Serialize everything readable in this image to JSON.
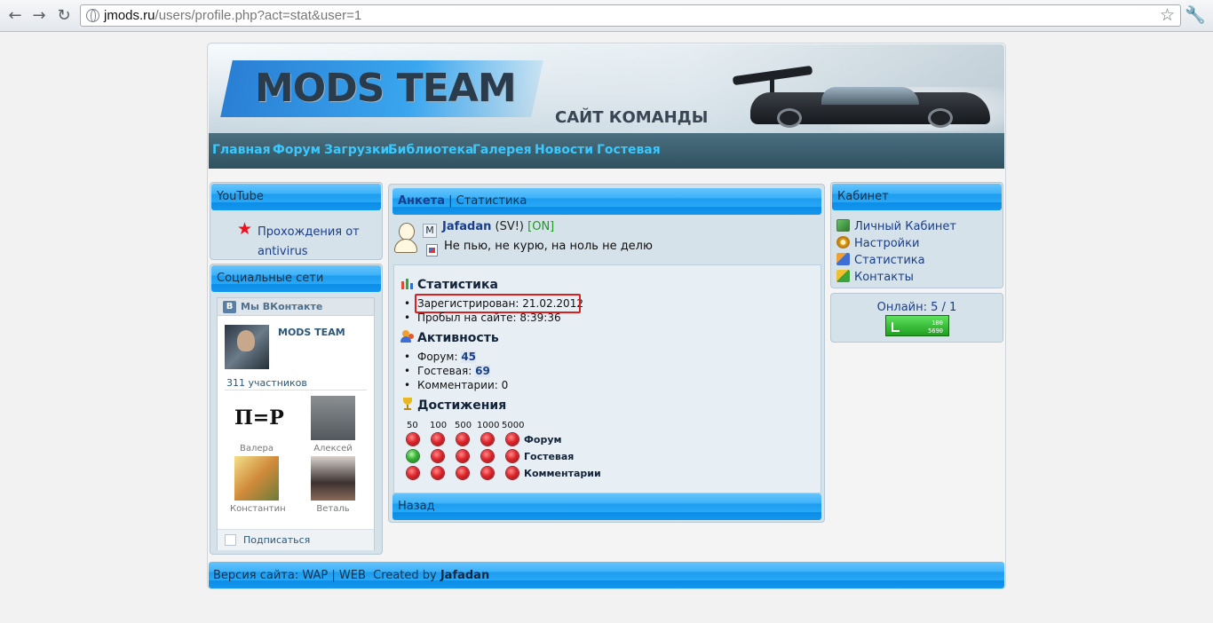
{
  "browser": {
    "back_icon": "arrow-left-icon",
    "forward_icon": "arrow-right-icon",
    "reload_icon": "reload-icon",
    "url_host": "jmods.ru",
    "url_path": "/users/profile.php?act=stat&user=1",
    "bookmark_icon": "star-icon",
    "menu_icon": "wrench-icon"
  },
  "banner": {
    "logo": "MODS TEAM",
    "slogan": "САЙТ КОМАНДЫ"
  },
  "nav": {
    "items": [
      "Главная",
      "Форум",
      "Загрузки",
      "Библиотека",
      "Галерея",
      "Новости",
      "Гостевая"
    ]
  },
  "left": {
    "youtube_title": "YouTube",
    "youtube_link": "Прохождения от antivirus",
    "social_title": "Социальные сети",
    "vk": {
      "header": "Мы ВКонтакте",
      "logo_letter": "В",
      "group_name": "MODS TEAM",
      "members_count": "311 участников",
      "members": [
        {
          "name": "Валера",
          "badge": "П=Р"
        },
        {
          "name": "Алексей"
        },
        {
          "name": "Константин"
        },
        {
          "name": "Веталь"
        }
      ],
      "subscribe": "Подписаться"
    }
  },
  "center": {
    "tab_active": "Анкета",
    "tab_separator": " | ",
    "tab_other": "Статистика",
    "profile": {
      "initial": "M",
      "username": "Jafadan",
      "suffix": " (SV!) ",
      "online_tag": "[ON]",
      "status": "Не пью, не курю, на ноль не делю"
    },
    "stats_title": "Статистика",
    "registered_label": "Зарегистрирован: ",
    "registered_value": "21.02.2012",
    "time_label": "Пробыл на сайте: ",
    "time_value": "8:39:36",
    "activity_title": "Активность",
    "forum_label": "Форум: ",
    "forum_value": "45",
    "guest_label": "Гостевая: ",
    "guest_value": "69",
    "comments_label": "Комментарии: ",
    "comments_value": "0",
    "achievements_title": "Достижения",
    "tiers": [
      "50",
      "100",
      "500",
      "1000",
      "5000"
    ],
    "achievement_rows": [
      {
        "label": "Форум",
        "done": [
          false,
          false,
          false,
          false,
          false
        ]
      },
      {
        "label": "Гостевая",
        "done": [
          true,
          false,
          false,
          false,
          false
        ]
      },
      {
        "label": "Комментарии",
        "done": [
          false,
          false,
          false,
          false,
          false
        ]
      }
    ],
    "back": "Назад"
  },
  "right": {
    "cabinet_title": "Кабинет",
    "cabinet_items": [
      "Личный Кабинет",
      "Настройки",
      "Статистика",
      "Контакты"
    ],
    "online": "Онлайн: 5 / 1",
    "counter_top": "100",
    "counter_bottom": "5690"
  },
  "footer": {
    "prefix": "Версия сайта: ",
    "wap": "WAP",
    "sep": " | ",
    "web": "WEB",
    "created": "  Created by ",
    "author": "Jafadan"
  },
  "colors": {
    "link_blue": "#1a3e8a",
    "nav_cyan": "#39c9ff",
    "bar_blue": "#1e9cf0",
    "highlight_red": "#dc1e1e",
    "online_green": "#1e9a1e"
  }
}
